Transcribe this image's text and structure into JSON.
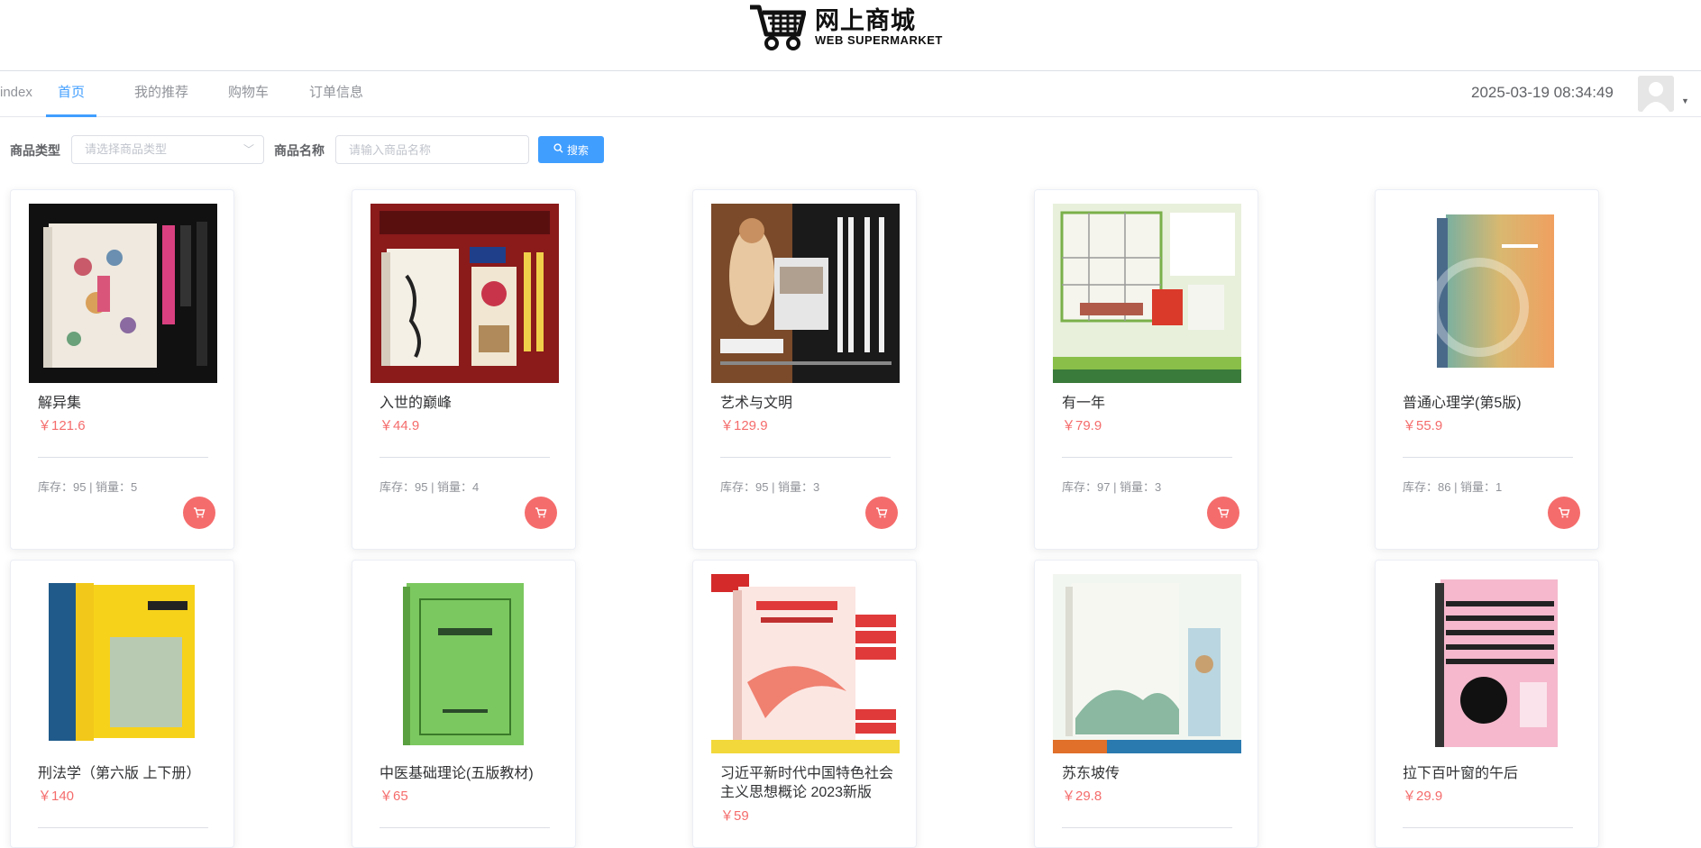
{
  "logo": {
    "cn": "网上商城",
    "en": "WEB SUPERMARKET",
    "icon": "shopping-cart-icon"
  },
  "nav": {
    "items": [
      {
        "label": "index"
      },
      {
        "label": "首页"
      },
      {
        "label": "我的推荐"
      },
      {
        "label": "购物车"
      },
      {
        "label": "订单信息"
      }
    ],
    "active": "首页",
    "datetime": "2025-03-19 08:34:49"
  },
  "filter": {
    "type_label": "商品类型",
    "type_placeholder": "请选择商品类型",
    "name_label": "商品名称",
    "name_placeholder": "请输入商品名称",
    "search_label": "搜索"
  },
  "products": [
    {
      "name": "解异集",
      "price": "￥121.6",
      "stock": "库存：95 | 销量：5"
    },
    {
      "name": "入世的巅峰",
      "price": "￥44.9",
      "stock": "库存：95 | 销量：4"
    },
    {
      "name": "艺术与文明",
      "price": "￥129.9",
      "stock": "库存：95 | 销量：3"
    },
    {
      "name": "有一年",
      "price": "￥79.9",
      "stock": "库存：97 | 销量：3"
    },
    {
      "name": "普通心理学(第5版)",
      "price": "￥55.9",
      "stock": "库存：86 | 销量：1"
    },
    {
      "name": "刑法学（第六版 上下册）",
      "price": "￥140",
      "stock": ""
    },
    {
      "name": "中医基础理论(五版教材)",
      "price": "￥65",
      "stock": ""
    },
    {
      "name": "习近平新时代中国特色社会主义思想概论 2023新版",
      "price": "￥59",
      "stock": ""
    },
    {
      "name": "苏东坡传",
      "price": "￥29.8",
      "stock": ""
    },
    {
      "name": "拉下百叶窗的午后",
      "price": "￥29.9",
      "stock": ""
    }
  ],
  "colors": {
    "accent": "#409eff",
    "price": "#f56c6c",
    "cart": "#f56c6c"
  }
}
